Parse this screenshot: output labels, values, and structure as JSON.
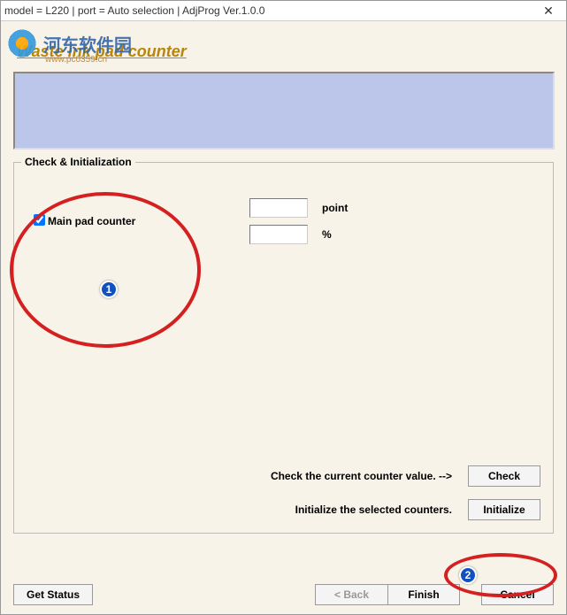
{
  "window": {
    "title": "model = L220 | port = Auto selection | AdjProg Ver.1.0.0"
  },
  "watermark": {
    "site_name": "河东软件园",
    "url": "www.pc0359.cn"
  },
  "page": {
    "title": "Waste ink pad counter"
  },
  "group": {
    "title": "Check & Initialization",
    "main_pad_label": "Main pad counter",
    "unit_point": "point",
    "unit_percent": "%",
    "point_value": "",
    "percent_value": ""
  },
  "instructions": {
    "check_text": "Check the current counter value. -->",
    "init_text": "Initialize the selected counters."
  },
  "buttons": {
    "check": "Check",
    "initialize": "Initialize",
    "get_status": "Get Status",
    "back": "< Back",
    "finish": "Finish",
    "cancel": "Cancel"
  },
  "annotations": {
    "badge1": "1",
    "badge2": "2"
  }
}
